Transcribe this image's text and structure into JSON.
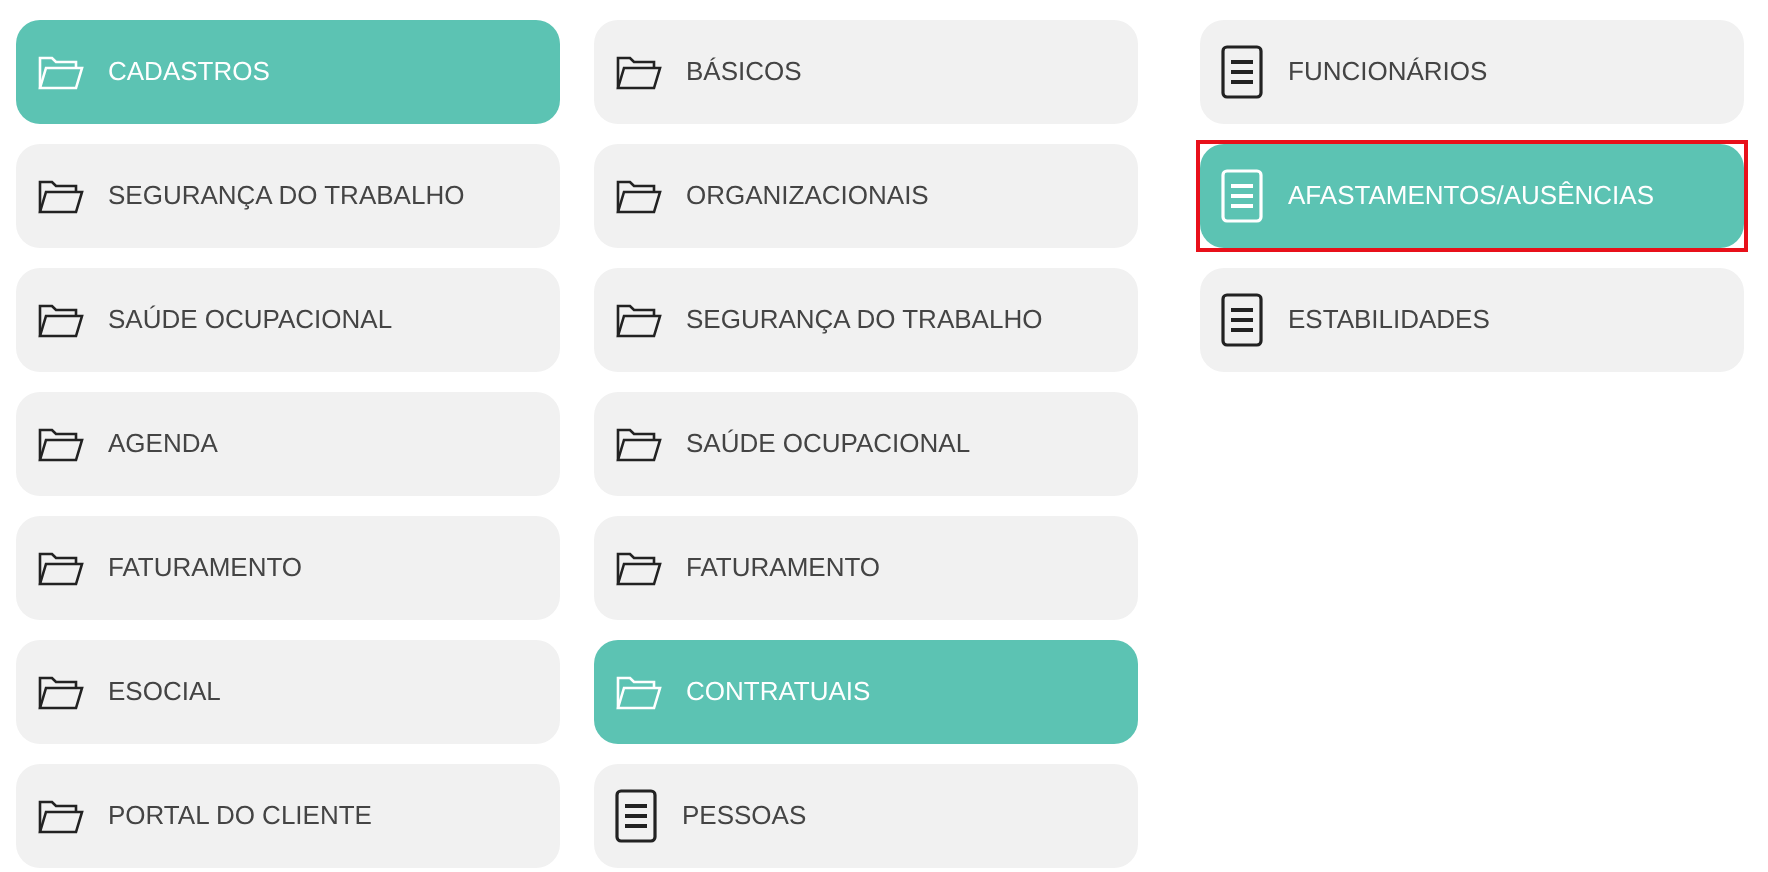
{
  "columns": [
    {
      "items": [
        {
          "kind": "folder",
          "label": "CADASTROS",
          "selected": true,
          "outlined": false
        },
        {
          "kind": "folder",
          "label": "SEGURANÇA DO TRABALHO",
          "selected": false,
          "outlined": false
        },
        {
          "kind": "folder",
          "label": "SAÚDE OCUPACIONAL",
          "selected": false,
          "outlined": false
        },
        {
          "kind": "folder",
          "label": "AGENDA",
          "selected": false,
          "outlined": false
        },
        {
          "kind": "folder",
          "label": "FATURAMENTO",
          "selected": false,
          "outlined": false
        },
        {
          "kind": "folder",
          "label": "ESOCIAL",
          "selected": false,
          "outlined": false
        },
        {
          "kind": "folder",
          "label": "PORTAL DO CLIENTE",
          "selected": false,
          "outlined": false
        }
      ]
    },
    {
      "items": [
        {
          "kind": "folder",
          "label": "BÁSICOS",
          "selected": false,
          "outlined": false
        },
        {
          "kind": "folder",
          "label": "ORGANIZACIONAIS",
          "selected": false,
          "outlined": false
        },
        {
          "kind": "folder",
          "label": "SEGURANÇA DO TRABALHO",
          "selected": false,
          "outlined": false
        },
        {
          "kind": "folder",
          "label": "SAÚDE OCUPACIONAL",
          "selected": false,
          "outlined": false
        },
        {
          "kind": "folder",
          "label": "FATURAMENTO",
          "selected": false,
          "outlined": false
        },
        {
          "kind": "folder",
          "label": "CONTRATUAIS",
          "selected": true,
          "outlined": false
        },
        {
          "kind": "document",
          "label": "PESSOAS",
          "selected": false,
          "outlined": false
        }
      ]
    },
    {
      "items": [
        {
          "kind": "document",
          "label": "FUNCIONÁRIOS",
          "selected": false,
          "outlined": false
        },
        {
          "kind": "document",
          "label": "AFASTAMENTOS/AUSÊNCIAS",
          "selected": true,
          "outlined": true
        },
        {
          "kind": "document",
          "label": "ESTABILIDADES",
          "selected": false,
          "outlined": false
        }
      ]
    }
  ]
}
